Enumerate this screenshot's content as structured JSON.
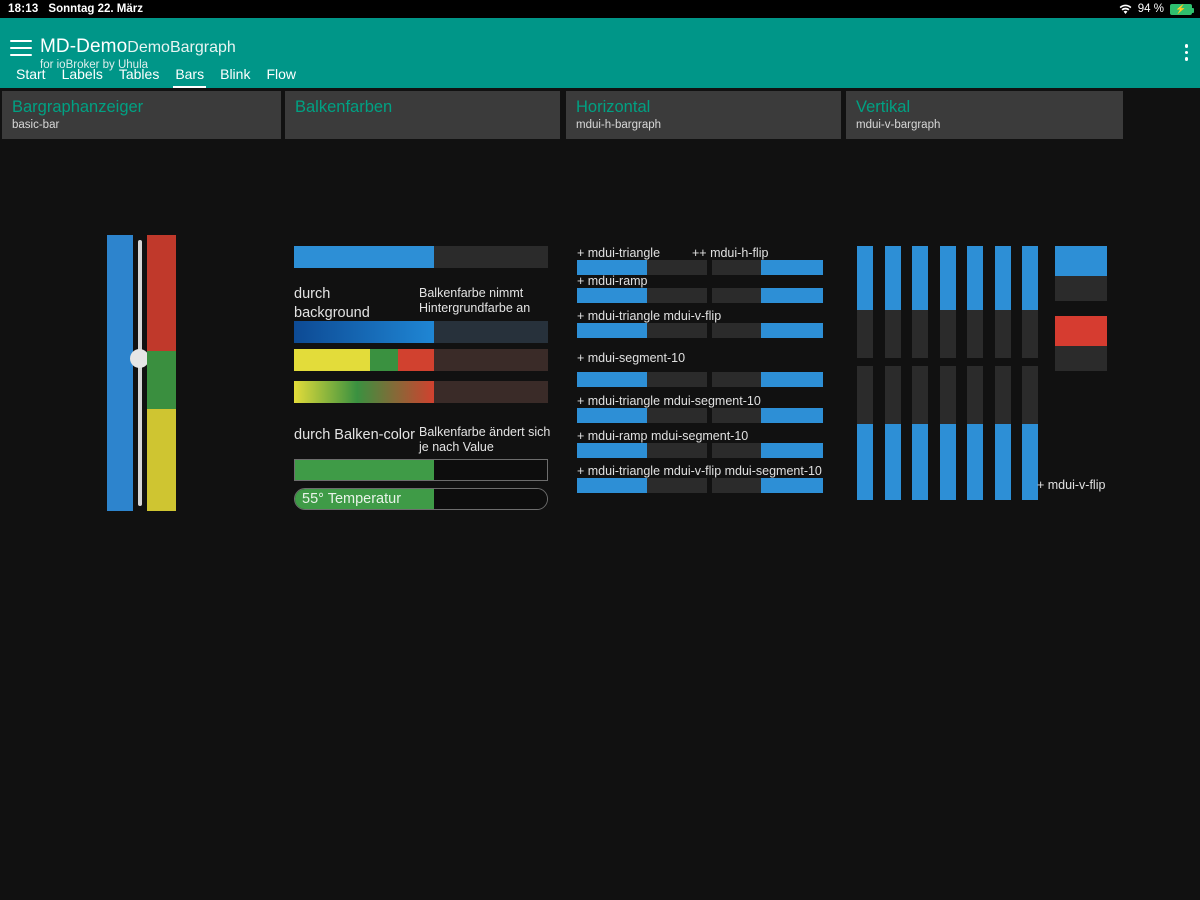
{
  "statusbar": {
    "time": "18:13",
    "date": "Sonntag 22. März",
    "battery_percent": "94 %",
    "wifi_icon": "wifi-icon",
    "battery_icon": "battery-charging-icon"
  },
  "appbar": {
    "menu_icon": "hamburger-menu-icon",
    "overflow_icon": "kebab-menu-icon",
    "title": "MD-Demo",
    "title_secondary": "DemoBargraph",
    "subtitle": "for ioBroker by Uhula",
    "accent_color": "#009688",
    "tabs": [
      {
        "label": "Start",
        "active": false
      },
      {
        "label": "Labels",
        "active": false
      },
      {
        "label": "Tables",
        "active": false
      },
      {
        "label": "Bars",
        "active": true
      },
      {
        "label": "Blink",
        "active": false
      },
      {
        "label": "Flow",
        "active": false
      }
    ]
  },
  "cards": [
    {
      "title": "Bargraphanzeiger",
      "subtitle": "basic-bar",
      "bars": {
        "blue_bar_color": "#2d84cd",
        "slider_value_y": "261",
        "multi_segments": [
          {
            "color": "#c0392b",
            "percent": 42
          },
          {
            "color": "#3a8f3f",
            "percent": 21
          },
          {
            "color": "#cfc531",
            "percent": 37
          }
        ]
      }
    },
    {
      "title": "Balkenfarben",
      "subtitle": "",
      "label_background": "durch background",
      "desc_background": "Balkenfarbe nimmt Hintergrundfarbe an",
      "label_barcolor": "durch Balken-color",
      "desc_barcolor": "Balkenfarbe ändert sich je nach Value",
      "bars": [
        {
          "name": "plain-blue",
          "fill": "#2d8fd6",
          "rest": "#2b2b2b",
          "value": 55
        },
        {
          "name": "gradient-blue",
          "fill": "linear-gradient(90deg,#0d4a94,#1f86d4)",
          "rest": "#27313b",
          "value": 55
        },
        {
          "name": "segmented-yellow-green-red",
          "fill": "segments",
          "rest": "#3a2b28",
          "value": 55
        },
        {
          "name": "smooth-gradient",
          "fill": "linear-gradient(90deg,#e3dc3a,#3a9140,#d1412f)",
          "rest": "#3a2b28",
          "value": 55
        },
        {
          "name": "green-value-bar",
          "fill": "#3f9b47",
          "rest": "#0d0d0d",
          "value": 55
        },
        {
          "name": "temperature-bar",
          "fill": "#3f9b47",
          "rest": "#0d0d0d",
          "value": 55,
          "text": "55° Temperatur"
        }
      ],
      "segment_colors": [
        "#e3dc3a",
        "#3a9140",
        "#d1412f"
      ]
    },
    {
      "title": "Horizontal",
      "subtitle": "mdui-h-bargraph",
      "labels": [
        "+ mdui-triangle",
        "++ mdui-h-flip",
        "+ mdui-ramp",
        "+ mdui-triangle mdui-v-flip",
        "+ mdui-segment-10",
        "+ mdui-triangle mdui-segment-10",
        "+ mdui-ramp mdui-segment-10",
        "+ mdui-triangle mdui-v-flip mdui-segment-10"
      ],
      "bar_color": "#2d8fd6",
      "track_color": "#2b2b2b",
      "value": 50
    },
    {
      "title": "Vertikal",
      "subtitle": "mdui-v-bargraph",
      "note": "+ mdui-v-flip",
      "bar_color": "#2d8fd6",
      "track_color": "#2b2b2b",
      "accent_red": "#d63c30",
      "column_count": 7,
      "value": 57
    }
  ]
}
